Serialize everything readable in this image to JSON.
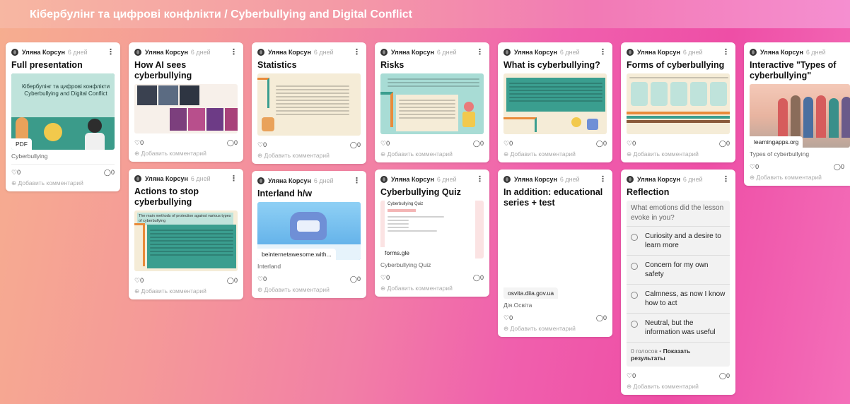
{
  "board": {
    "title": "Кібербулінг та цифрові конфлікти / Cyberbullying and Digital Conflict"
  },
  "common": {
    "author": "Уляна Корсун",
    "time": "6 дней",
    "add_comment": "Добавить комментарий",
    "likes": "0",
    "comments": "0"
  },
  "cards": {
    "full": {
      "title": "Full presentation",
      "slide_text": "Кібербулінг та цифрові конфлікти Cyberbullying and Digital Conflict",
      "badge": "PDF",
      "sub": "Cyberbullying"
    },
    "ai": {
      "title": "How AI sees cyberbullying"
    },
    "actions": {
      "title": "Actions to stop cyberbullying",
      "slide_heading": "The main methods of protection against various types of cyberbullying"
    },
    "stats": {
      "title": "Statistics"
    },
    "interland": {
      "title": "Interland h/w",
      "badge": "beinternetawesome.with...",
      "sub": "Interland"
    },
    "risks": {
      "title": "Risks"
    },
    "quiz": {
      "title": "Cyberbullying Quiz",
      "preview_title": "Cyberbullying Quiz",
      "badge": "forms.gle",
      "sub": "Cyberbullying Quiz"
    },
    "what": {
      "title": "What is cyberbullying?"
    },
    "edu": {
      "title": "In addition: educational series + test",
      "badge": "osvita.diia.gov.ua",
      "sub": "Дія.Освіта"
    },
    "forms": {
      "title": "Forms of cyberbullying"
    },
    "reflection": {
      "title": "Reflection",
      "question": "What emotions did the lesson evoke in you?",
      "options": [
        "Curiosity and a desire to learn more",
        "Concern for my own safety",
        "Calmness, as now I know how to act",
        "Neutral, but the information was useful"
      ],
      "votes": "0 голосов",
      "show_results": "Показать результаты"
    },
    "interactive": {
      "title": "Interactive \"Types of cyberbullying\"",
      "badge": "learningapps.org",
      "sub": "Types of cyberbullying"
    }
  },
  "colors": {
    "accent": "#ee4ea6",
    "teal": "#3a9e8f",
    "cream": "#f5ecd7"
  }
}
